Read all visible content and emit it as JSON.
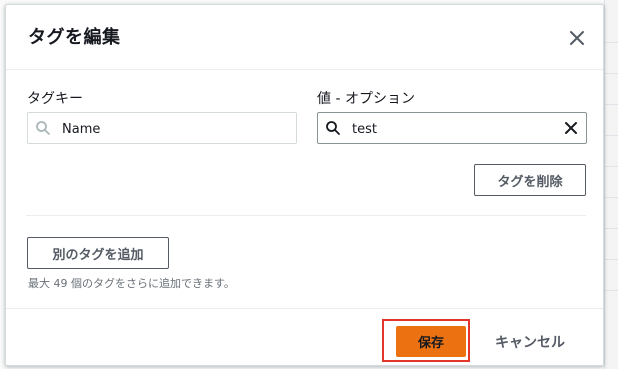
{
  "dialog": {
    "title": "タグを編集"
  },
  "tag_row": {
    "key_label": "タグキー",
    "key_value": "Name",
    "value_label": "値 - オプション",
    "value_value": "test",
    "remove_label": "タグを削除"
  },
  "add_tag": {
    "label": "別のタグを追加",
    "hint": "最大 49 個のタグをさらに追加できます。"
  },
  "footer": {
    "save_label": "保存",
    "cancel_label": "キャンセル"
  },
  "colors": {
    "primary": "#ec7211",
    "highlight": "#e4352a",
    "text": "#16191f",
    "secondary_text": "#545b64"
  },
  "icons": [
    "close-icon",
    "search-icon",
    "clear-icon"
  ]
}
